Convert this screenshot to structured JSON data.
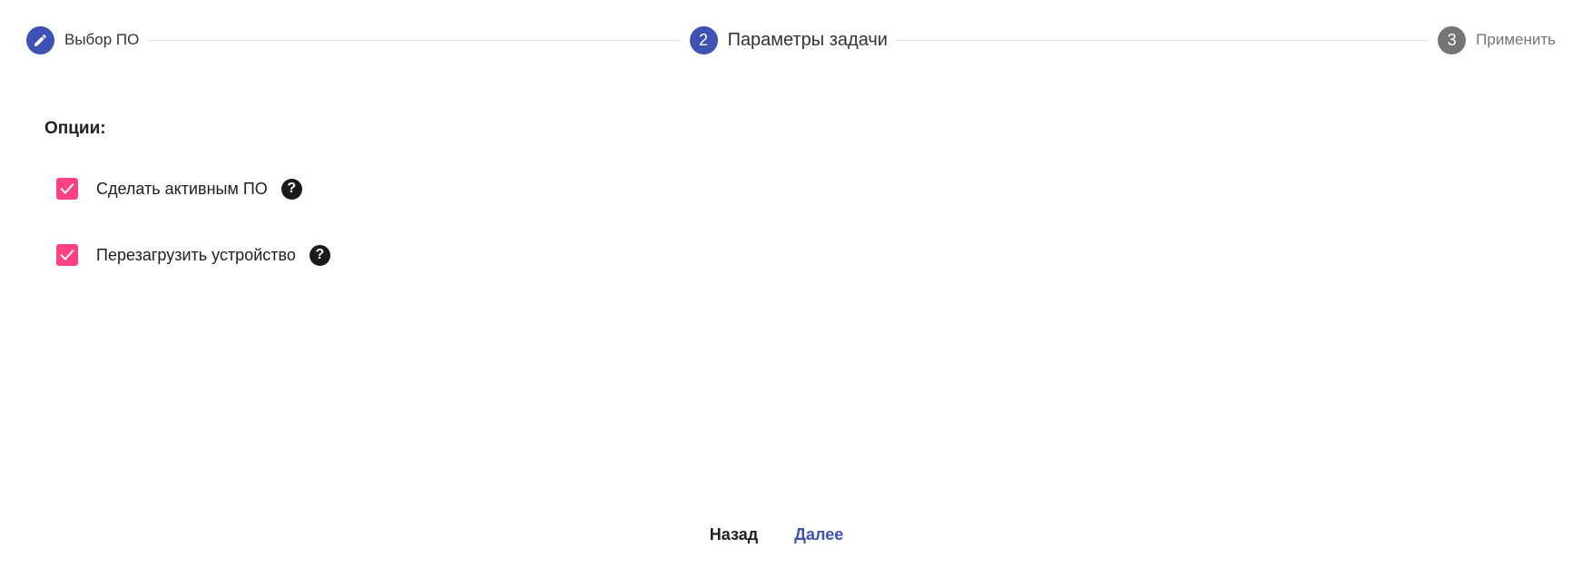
{
  "stepper": {
    "steps": [
      {
        "number": "",
        "label": "Выбор ПО",
        "state": "done",
        "icon": "pencil-icon"
      },
      {
        "number": "2",
        "label": "Параметры задачи",
        "state": "active"
      },
      {
        "number": "3",
        "label": "Применить",
        "state": "pending"
      }
    ]
  },
  "options": {
    "title": "Опции:",
    "items": [
      {
        "label": "Сделать активным ПО",
        "checked": true,
        "help_icon": "help-circle-icon",
        "help_glyph": "?"
      },
      {
        "label": "Перезагрузить устройство",
        "checked": true,
        "help_icon": "help-circle-icon",
        "help_glyph": "?"
      }
    ]
  },
  "actions": {
    "back_label": "Назад",
    "next_label": "Далее"
  },
  "colors": {
    "primary": "#3f51b5",
    "accent": "#ff4081",
    "pending": "#757575",
    "divider": "#e0e0e0"
  }
}
